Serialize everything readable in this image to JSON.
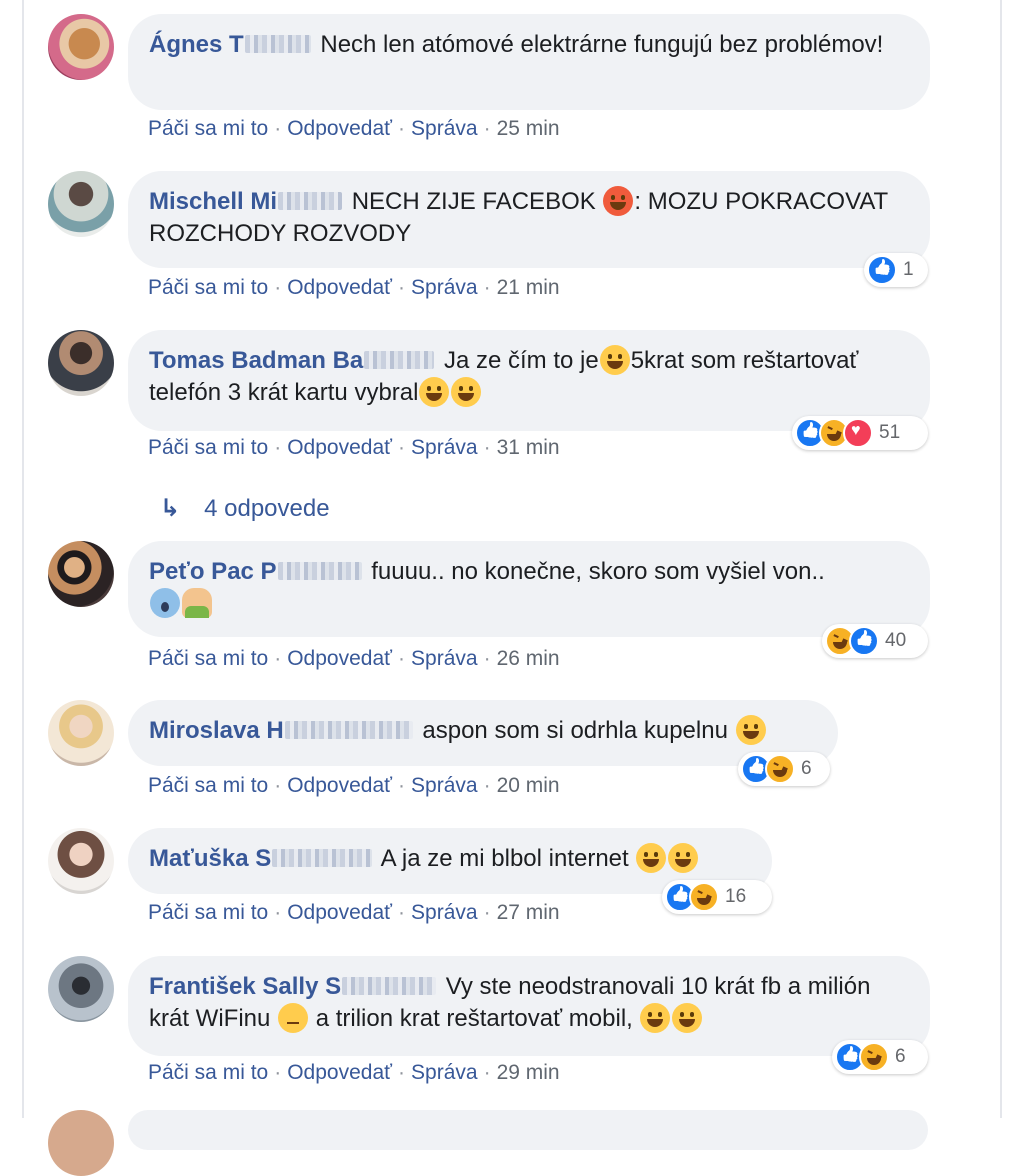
{
  "actions": {
    "like": "Páči sa mi to",
    "reply": "Odpovedať",
    "message": "Správa"
  },
  "comments": [
    {
      "author": "Ágnes T",
      "text": "Nech len atómové elektrárne fungujú bez problémov!",
      "time": "25 min"
    },
    {
      "author": "Mischell Mi",
      "text_a": "NECH ZIJE FACEBOK",
      "text_b": ": MOZU POKRACOVAT ROZCHODY ROZVODY",
      "time": "21 min",
      "reactions": {
        "count": "1",
        "types": [
          "like"
        ]
      }
    },
    {
      "author": "Tomas Badman Ba",
      "text_a": "Ja ze čím to je",
      "text_b": "5krat som reštartovať telefón 3 krát kartu vybral",
      "time": "31 min",
      "reactions": {
        "count": "51",
        "types": [
          "like",
          "haha",
          "love"
        ]
      }
    },
    {
      "author": "Peťo Pac P",
      "text": "fuuuu.. no konečne, skoro som vyšiel von..",
      "time": "26 min",
      "reactions": {
        "count": "40",
        "types": [
          "haha",
          "like"
        ]
      }
    },
    {
      "author": "Miroslava H",
      "text": "aspon som si odrhla kupelnu",
      "time": "20 min",
      "reactions": {
        "count": "6",
        "types": [
          "like",
          "haha"
        ]
      }
    },
    {
      "author": "Maťuška S",
      "text": "A ja ze mi blbol internet",
      "time": "27 min",
      "reactions": {
        "count": "16",
        "types": [
          "like",
          "haha"
        ]
      }
    },
    {
      "author": "František Sally S",
      "text_a": "Vy ste neodstranovali 10 krát fb a milión krát WiFinu",
      "text_b": "a trilion krat reštartovať mobil,",
      "time": "29 min",
      "reactions": {
        "count": "6",
        "types": [
          "like",
          "haha"
        ]
      }
    }
  ],
  "replies_link": {
    "icon": "reply-arrow-icon",
    "label": "4 odpovede"
  }
}
